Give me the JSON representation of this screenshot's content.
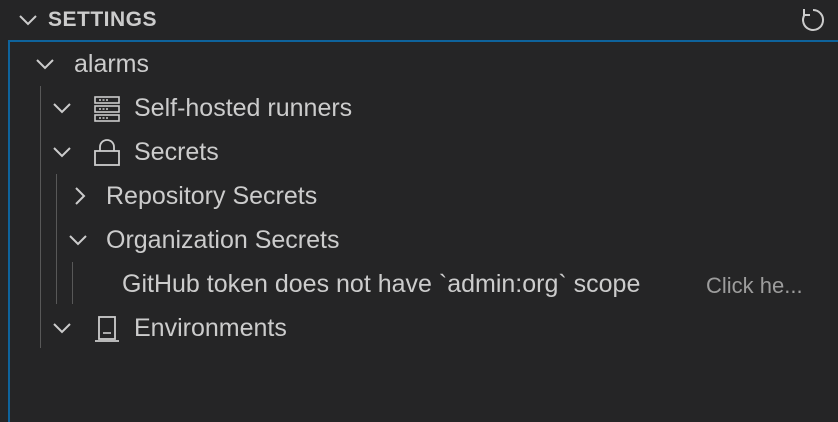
{
  "header": {
    "title": "SETTINGS",
    "collapse_icon": "chevron-down-icon",
    "refresh_icon": "refresh-icon"
  },
  "tree": {
    "root": {
      "label": "alarms",
      "expanded": true
    },
    "items": [
      {
        "label": "Self-hosted runners",
        "icon": "server-icon",
        "expanded": true
      },
      {
        "label": "Secrets",
        "icon": "lock-icon",
        "expanded": true
      },
      {
        "label": "Repository Secrets",
        "expanded": false
      },
      {
        "label": "Organization Secrets",
        "expanded": true
      },
      {
        "label": "GitHub token does not have `admin:org` scope",
        "description": "Click he..."
      },
      {
        "label": "Environments",
        "icon": "environment-icon",
        "expanded": true
      }
    ]
  },
  "colors": {
    "background": "#252526",
    "text": "#cccccc",
    "description": "#9d9d9d",
    "focus_border": "#0e639c",
    "indent_guide": "#585858"
  }
}
